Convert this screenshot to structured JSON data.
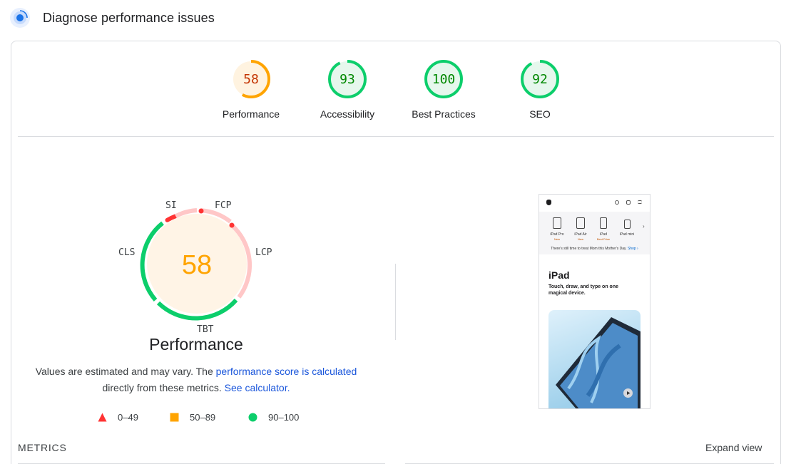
{
  "header": {
    "title": "Diagnose performance issues"
  },
  "categories": [
    {
      "label": "Performance",
      "score": "58",
      "score_num": 58,
      "color": "#ffa400",
      "text_color": "#c33300",
      "bg": "#fff3e0"
    },
    {
      "label": "Accessibility",
      "score": "93",
      "score_num": 93,
      "color": "#0cce6b",
      "text_color": "#008800",
      "bg": "#e6f7ed"
    },
    {
      "label": "Best Practices",
      "score": "100",
      "score_num": 100,
      "color": "#0cce6b",
      "text_color": "#008800",
      "bg": "#e6f7ed"
    },
    {
      "label": "SEO",
      "score": "92",
      "score_num": 92,
      "color": "#0cce6b",
      "text_color": "#008800",
      "bg": "#e6f7ed"
    }
  ],
  "performance": {
    "score": "58",
    "title": "Performance",
    "desc_part1": "Values are estimated and may vary. The ",
    "desc_link1": "performance score is calculated",
    "desc_part2": "directly from these metrics. ",
    "desc_link2": "See calculator.",
    "metric_tags": {
      "si": "SI",
      "fcp": "FCP",
      "lcp": "LCP",
      "tbt": "TBT",
      "cls": "CLS"
    }
  },
  "legend": [
    {
      "shape": "triangle",
      "label": "0–49",
      "color": "#ff3333"
    },
    {
      "shape": "square",
      "label": "50–89",
      "color": "#ffa400"
    },
    {
      "shape": "circle",
      "label": "90–100",
      "color": "#0cce6b"
    }
  ],
  "metrics": {
    "label": "METRICS",
    "expand_label": "Expand view"
  },
  "thumbnail": {
    "products": [
      {
        "name": "iPad Pro",
        "tag": "New"
      },
      {
        "name": "iPad Air",
        "tag": "New"
      },
      {
        "name": "iPad",
        "tag": "Best Price"
      },
      {
        "name": "iPad mini",
        "tag": ""
      }
    ],
    "banner_text": "There's still time to treat Mom this Mother's Day.",
    "banner_link": "Shop ›",
    "heading": "iPad",
    "subheading": "Touch, draw, and type on one magical device."
  },
  "icons": {
    "header": "lighthouse-target-icon",
    "nav": [
      "apple-logo-icon",
      "search-icon",
      "bag-icon",
      "menu-icon"
    ],
    "play": "play-icon"
  }
}
